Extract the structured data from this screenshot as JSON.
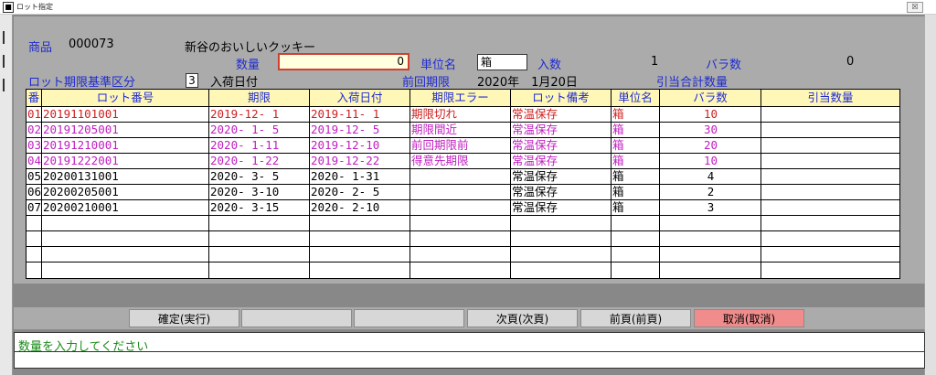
{
  "window": {
    "title": "ロット指定",
    "close_label": "☒"
  },
  "product": {
    "label": "商品",
    "code": "000073",
    "name": "新谷のおいしいクッキー"
  },
  "qty": {
    "label": "数量",
    "value": "0"
  },
  "unit": {
    "label": "単位名",
    "value": "箱"
  },
  "irisu": {
    "label": "入数",
    "value": "1"
  },
  "bara": {
    "label": "バラ数",
    "value": "0"
  },
  "lot_basis": {
    "label": "ロット期限基準区分",
    "value": "3",
    "text": "入荷日付"
  },
  "prev_limit": {
    "label": "前回期限",
    "value": "2020年　1月20日"
  },
  "alloc_total": {
    "label": "引当合計数量"
  },
  "grid": {
    "headers": [
      "番",
      "ロット番号",
      "期限",
      "入荷日付",
      "期限エラー",
      "ロット備考",
      "単位名",
      "バラ数",
      "引当数量"
    ],
    "rows": [
      {
        "no": "01",
        "lot": "20191101001",
        "limit": "2019-12- 1",
        "arrival": "2019-11- 1",
        "error": "期限切れ",
        "note": "常温保存",
        "unit": "箱",
        "bara": "10",
        "alloc": "",
        "color": "#d02020"
      },
      {
        "no": "02",
        "lot": "20191205001",
        "limit": "2020- 1- 5",
        "arrival": "2019-12- 5",
        "error": "期限間近",
        "note": "常温保存",
        "unit": "箱",
        "bara": "30",
        "alloc": "",
        "color": "#c020c0"
      },
      {
        "no": "03",
        "lot": "20191210001",
        "limit": "2020- 1-11",
        "arrival": "2019-12-10",
        "error": "前回期限前",
        "note": "常温保存",
        "unit": "箱",
        "bara": "20",
        "alloc": "",
        "color": "#c020c0"
      },
      {
        "no": "04",
        "lot": "20191222001",
        "limit": "2020- 1-22",
        "arrival": "2019-12-22",
        "error": "得意先期限",
        "note": "常温保存",
        "unit": "箱",
        "bara": "10",
        "alloc": "",
        "color": "#c020c0"
      },
      {
        "no": "05",
        "lot": "20200131001",
        "limit": "2020- 3- 5",
        "arrival": "2020- 1-31",
        "error": "",
        "note": "常温保存",
        "unit": "箱",
        "bara": "4",
        "alloc": "",
        "color": "#000000"
      },
      {
        "no": "06",
        "lot": "20200205001",
        "limit": "2020- 3-10",
        "arrival": "2020- 2- 5",
        "error": "",
        "note": "常温保存",
        "unit": "箱",
        "bara": "2",
        "alloc": "",
        "color": "#000000"
      },
      {
        "no": "07",
        "lot": "20200210001",
        "limit": "2020- 3-15",
        "arrival": "2020- 2-10",
        "error": "",
        "note": "常温保存",
        "unit": "箱",
        "bara": "3",
        "alloc": "",
        "color": "#000000"
      }
    ],
    "empty_rows": 4
  },
  "buttons": {
    "confirm": "確定(実行)",
    "blank1": "",
    "blank2": "",
    "next": "次頁(次頁)",
    "prev": "前頁(前頁)",
    "cancel": "取消(取消)"
  },
  "status": {
    "message": "数量を入力してください"
  }
}
